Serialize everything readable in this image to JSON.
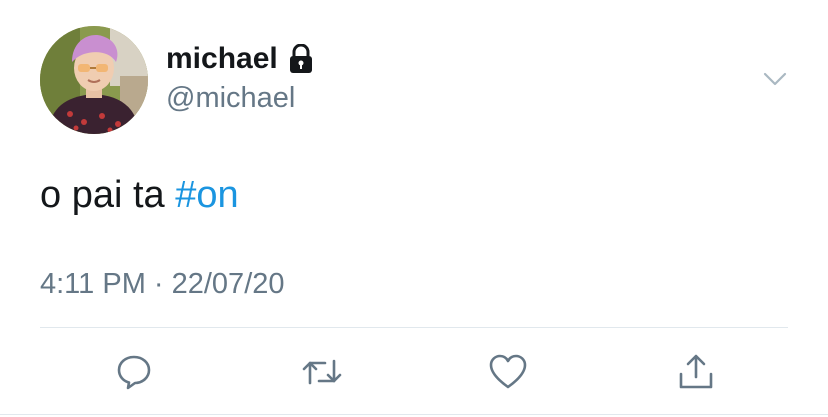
{
  "author": {
    "display_name": "michael",
    "handle": "@michael",
    "avatar_icon": "avatar-photo",
    "protected_icon": "lock-icon"
  },
  "tweet": {
    "text_prefix": "o pai ta ",
    "hashtag": "#on",
    "timestamp": "4:11 PM · 22/07/20"
  },
  "actions": {
    "reply_icon": "reply-icon",
    "retweet_icon": "retweet-icon",
    "like_icon": "heart-icon",
    "share_icon": "share-icon",
    "menu_icon": "chevron-down-icon"
  },
  "colors": {
    "text": "#14171a",
    "secondary": "#657786",
    "link": "#1b95e0",
    "divider": "#e1e8ed"
  }
}
